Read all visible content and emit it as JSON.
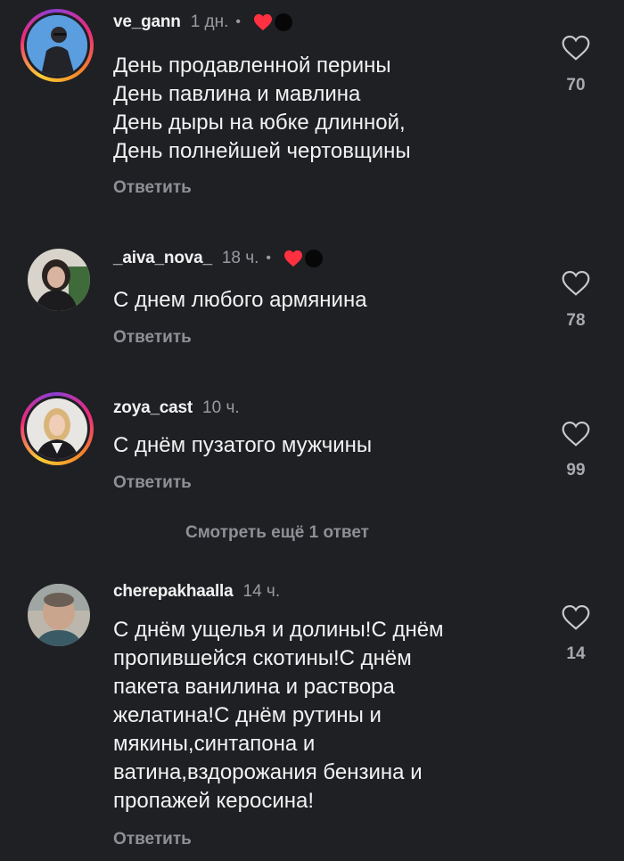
{
  "comments": [
    {
      "username": "ve_gann",
      "time": "1 дн.",
      "separator": "•",
      "text": "День продавленной перины\nДень павлина и мавлина\nДень дыры на юбке длинной,\nДень полнейшей чертовщины",
      "reply_label": "Ответить",
      "likes": "70",
      "liked_by_author": true,
      "has_story_ring": true
    },
    {
      "username": "_aiva_nova_",
      "time": "18 ч.",
      "separator": "•",
      "text": "С днем любого армянина",
      "reply_label": "Ответить",
      "likes": "78",
      "liked_by_author": true,
      "has_story_ring": false
    },
    {
      "username": "zoya_cast",
      "time": "10 ч.",
      "text": "С днём пузатого мужчины",
      "reply_label": "Ответить",
      "likes": "99",
      "liked_by_author": false,
      "has_story_ring": true
    },
    {
      "username": "cherepakhaalla",
      "time": "14 ч.",
      "text": "С днём ущелья и долины!С днём\nпропившейся скотины!С днём\nпакета ванилина и  раствора\nжелатина!С днём рутины и\nмякины,синтапона и\nватина,вздорожания бензина и\nпропажей керосина!",
      "reply_label": "Ответить",
      "likes": "14",
      "liked_by_author": false,
      "has_story_ring": false
    }
  ],
  "view_more_replies": "Смотреть ещё 1 ответ",
  "colors": {
    "background": "#1f2024",
    "text": "#f2f2f2",
    "muted": "#8f9096",
    "heart_red": "#ff3040"
  },
  "icons": {
    "like": "heart-outline-icon",
    "author_like": "heart-filled-icon"
  }
}
